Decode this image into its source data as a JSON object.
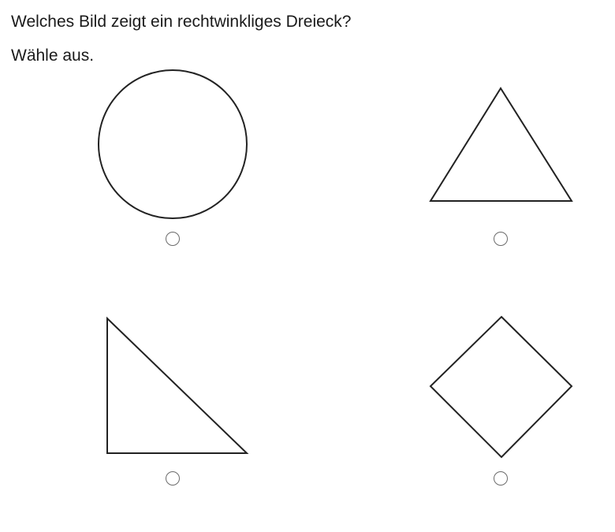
{
  "question": {
    "text": "Welches Bild zeigt ein rechtwinkliges Dreieck?",
    "instruction": "Wähle aus."
  },
  "options": [
    {
      "shape": "circle",
      "selected": false
    },
    {
      "shape": "triangle-equilateral",
      "selected": false
    },
    {
      "shape": "triangle-right",
      "selected": false
    },
    {
      "shape": "diamond",
      "selected": false
    }
  ],
  "colors": {
    "stroke": "#222222",
    "radio_border": "#6b6b6b",
    "background": "#ffffff"
  }
}
